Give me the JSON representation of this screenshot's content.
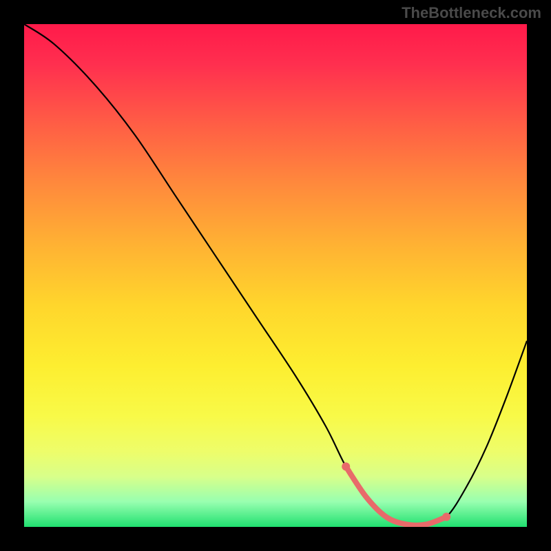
{
  "watermark": "TheBottleneck.com",
  "chart_data": {
    "type": "line",
    "title": "",
    "xlabel": "",
    "ylabel": "",
    "xlim": [
      0,
      100
    ],
    "ylim": [
      0,
      100
    ],
    "series": [
      {
        "name": "bottleneck-curve",
        "x": [
          0,
          6,
          14,
          22,
          30,
          38,
          46,
          54,
          60,
          64,
          68,
          72,
          76,
          80,
          84,
          88,
          92,
          96,
          100
        ],
        "y": [
          100,
          96,
          88,
          78,
          66,
          54,
          42,
          30,
          20,
          12,
          6,
          2,
          0.5,
          0.5,
          2,
          8,
          16,
          26,
          37
        ]
      }
    ],
    "accent_segment": {
      "name": "optimal-range",
      "x_start": 64,
      "x_end": 84,
      "y": 0.8,
      "color": "#e86a6a"
    },
    "background_gradient": {
      "top_color": "#ff1a4a",
      "mid_color": "#ffd62c",
      "bottom_color": "#20e070"
    }
  }
}
